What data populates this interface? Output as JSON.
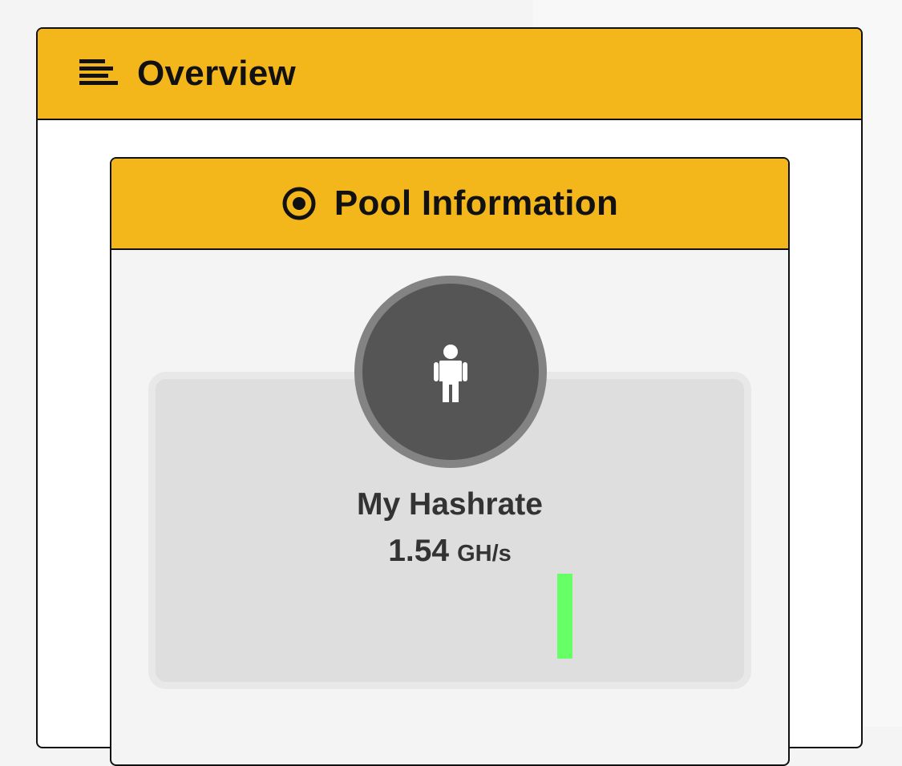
{
  "overview": {
    "title": "Overview",
    "icon": "menu-lines-icon"
  },
  "pool_info": {
    "title": "Pool Information",
    "icon": "target-icon",
    "hashrate": {
      "icon": "user-icon",
      "label": "My Hashrate",
      "value": "1.54",
      "unit": "GH/s",
      "sparkline_level": 1.0,
      "sparkline_color": "#66ff66"
    }
  },
  "colors": {
    "accent": "#f3b71c",
    "border": "#111111",
    "avatar_bg": "#555555",
    "avatar_ring": "#838383"
  }
}
